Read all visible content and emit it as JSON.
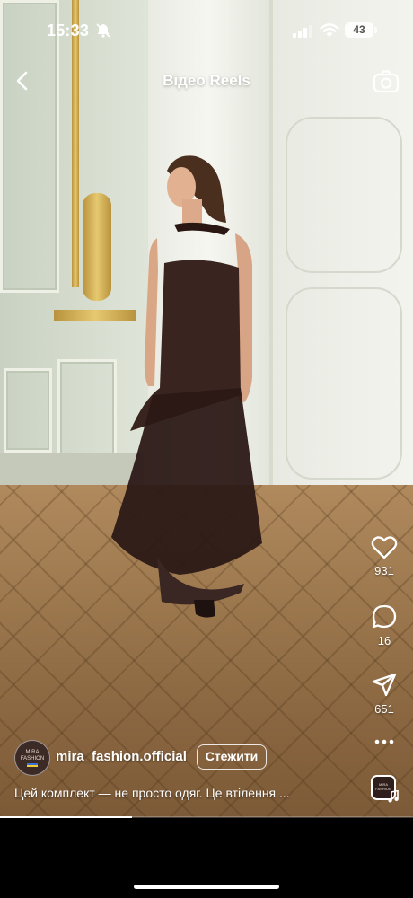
{
  "status_bar": {
    "time": "15:33",
    "battery": "43"
  },
  "header": {
    "title": "Відео Reels"
  },
  "actions": {
    "likes": "931",
    "comments": "16",
    "shares": "651"
  },
  "post": {
    "avatar_text": "MIRA FASHION",
    "username": "mira_fashion.official",
    "follow_label": "Стежити",
    "caption": "Цей комплект — не просто одяг. Це втілення ...",
    "progress": 0.32
  },
  "icons": {
    "back": "chevron-left-icon",
    "camera": "camera-icon",
    "like": "heart-icon",
    "comment": "comment-bubble-icon",
    "share": "paper-plane-icon",
    "more": "ellipsis-icon",
    "audio": "music-note-icon"
  }
}
